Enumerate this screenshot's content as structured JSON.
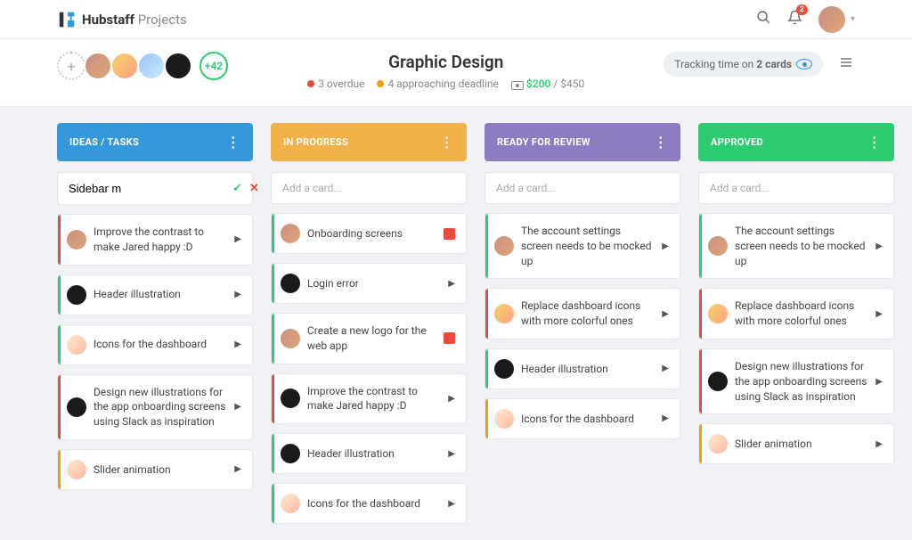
{
  "brand": {
    "name": "Hubstaff",
    "sub": "Projects"
  },
  "notifications": "2",
  "members_extra": "+42",
  "project": {
    "title": "Graphic Design",
    "overdue": "3 overdue",
    "approaching": "4 approaching deadline",
    "budget_spent": "$200",
    "budget_total": " / $450"
  },
  "tracking": {
    "prefix": "Tracking time on ",
    "bold": "2 cards"
  },
  "columns": {
    "c0": {
      "title": "IDEAS / TASKS",
      "color": "#3498db"
    },
    "c1": {
      "title": "IN PROGRESS",
      "color": "#f1b24a"
    },
    "c2": {
      "title": "READY FOR REVIEW",
      "color": "#8e7cc3"
    },
    "c3": {
      "title": "APPROVED",
      "color": "#2ecc71"
    }
  },
  "new_card": {
    "value": "Sidebar m"
  },
  "add_placeholder": "Add a card...",
  "cards": {
    "c0": [
      {
        "t": "Improve the contrast to make Jared happy :D",
        "av": "av-a",
        "s": "c-red"
      },
      {
        "t": "Header illustration",
        "av": "av-d",
        "s": "c-green"
      },
      {
        "t": "Icons for the dashboard",
        "av": "av-e",
        "s": "c-green"
      },
      {
        "t": "Design new illustrations for the app onboarding screens using Slack as inspiration",
        "av": "av-d",
        "s": "c-red"
      },
      {
        "t": "Slider animation",
        "av": "av-e",
        "s": "c-yellow"
      }
    ],
    "c1": [
      {
        "t": "Onboarding screens",
        "av": "av-a",
        "s": "c-green",
        "rec": true
      },
      {
        "t": "Login error",
        "av": "av-d",
        "s": "c-green"
      },
      {
        "t": "Create a new logo for the web app",
        "av": "av-a",
        "s": "c-green",
        "rec": true
      },
      {
        "t": "Improve the contrast to make Jared happy :D",
        "av": "av-d",
        "s": "c-red"
      },
      {
        "t": "Header illustration",
        "av": "av-d",
        "s": "c-green"
      },
      {
        "t": "Icons for the dashboard",
        "av": "av-e",
        "s": "c-green"
      }
    ],
    "c2": [
      {
        "t": "The account settings screen needs to be mocked up",
        "av": "av-a",
        "s": "c-green"
      },
      {
        "t": "Replace dashboard icons with more colorful ones",
        "av": "av-b",
        "s": "c-red"
      },
      {
        "t": "Header illustration",
        "av": "av-d",
        "s": "c-green"
      },
      {
        "t": "Icons for the dashboard",
        "av": "av-e",
        "s": "c-yellow"
      }
    ],
    "c3": [
      {
        "t": "The account settings screen needs to be mocked up",
        "av": "av-a",
        "s": "c-green"
      },
      {
        "t": "Replace dashboard icons with more colorful ones",
        "av": "av-b",
        "s": "c-red"
      },
      {
        "t": "Design new illustrations for the app onboarding screens using Slack as inspiration",
        "av": "av-d",
        "s": "c-red"
      },
      {
        "t": "Slider animation",
        "av": "av-e",
        "s": "c-yellow"
      }
    ]
  }
}
